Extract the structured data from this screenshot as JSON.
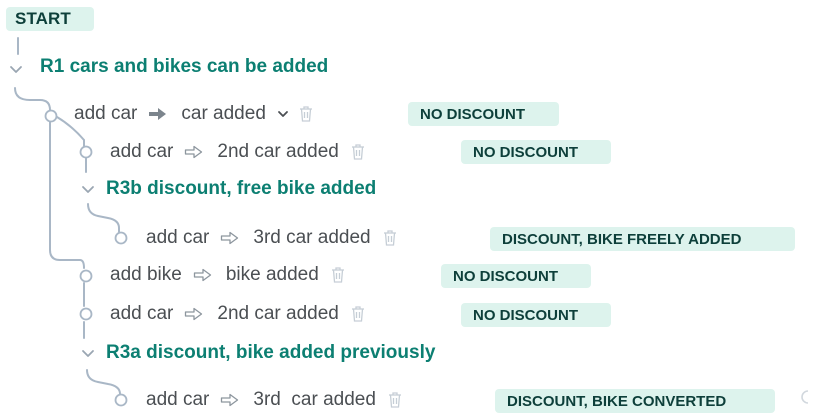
{
  "start_label": "START",
  "rules": [
    {
      "title": "R1 cars and bikes can be added"
    },
    {
      "title": "R3b discount, free bike added"
    },
    {
      "title": "R3a discount, bike added previously"
    }
  ],
  "steps": [
    {
      "action": "add car",
      "result": "car added",
      "badge": "NO DISCOUNT",
      "arrow": "solid-arrow-icon",
      "has_dropdown": true
    },
    {
      "action": "add car",
      "result": "2nd car added",
      "badge": "NO DISCOUNT",
      "arrow": "hollow-arrow-icon"
    },
    {
      "action": "add car",
      "result": "3rd car added",
      "badge": "DISCOUNT, BIKE FREELY ADDED",
      "arrow": "hollow-arrow-icon"
    },
    {
      "action": "add bike",
      "result": "bike added",
      "badge": "NO DISCOUNT",
      "arrow": "hollow-arrow-icon"
    },
    {
      "action": "add car",
      "result": "2nd car added",
      "badge": "NO DISCOUNT",
      "arrow": "hollow-arrow-icon"
    },
    {
      "action": "add car",
      "result": "3rd  car added",
      "badge": "DISCOUNT, BIKE CONVERTED",
      "arrow": "hollow-arrow-icon"
    }
  ],
  "colors": {
    "accent": "#0c7f72",
    "badge_bg": "#ddf3ed",
    "badge_text": "#0d3f3a",
    "line": "#a9b7c6",
    "text": "#4b4f53"
  },
  "icons": {
    "rule_toggle": "chevron-down-icon",
    "node": "circle-node-icon",
    "delete": "trash-icon",
    "more": "chevron-down-icon"
  }
}
